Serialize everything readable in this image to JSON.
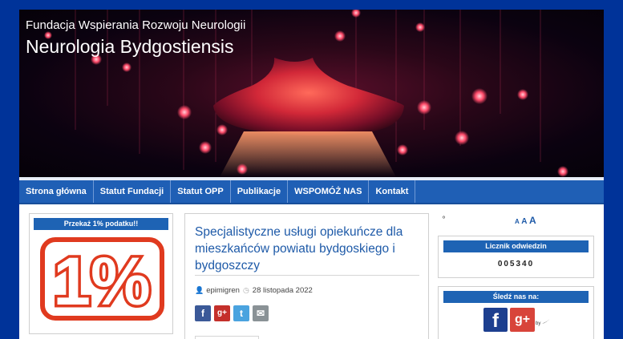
{
  "header": {
    "org_name": "Fundacja Wspierania Rozwoju Neurologii",
    "site_title": "Neurologia Bydgostiensis"
  },
  "nav": {
    "items": [
      {
        "label": "Strona główna"
      },
      {
        "label": "Statut Fundacji"
      },
      {
        "label": "Statut OPP"
      },
      {
        "label": "Publikacje"
      },
      {
        "label": "WSPOMÓŻ NAS"
      },
      {
        "label": "Kontakt"
      }
    ]
  },
  "left_widget": {
    "title": "Przekaż 1% podatku!!",
    "badge_text": "1%"
  },
  "post": {
    "title": "Specjalistyczne usługi opiekuńcze dla mieszkańców powiatu bydgoskiego i bydgoszczy",
    "author": "epimigren",
    "date": "28 listopada 2022",
    "share_buttons": [
      "facebook-share",
      "google-plus-share",
      "twitter-share",
      "email-share"
    ]
  },
  "font_tools": {
    "indicator": "º",
    "sizes": [
      "A",
      "A",
      "A"
    ]
  },
  "counter": {
    "title": "Licznik odwiedzin",
    "value": "005340"
  },
  "follow": {
    "title": "Śledź nas na:",
    "by_label": "by"
  },
  "colors": {
    "background": "#003399",
    "nav": "#1f5fb5",
    "widget_header": "#1e63b4",
    "title_blue": "#1e5aa8",
    "badge_red": "#e03a1f"
  }
}
